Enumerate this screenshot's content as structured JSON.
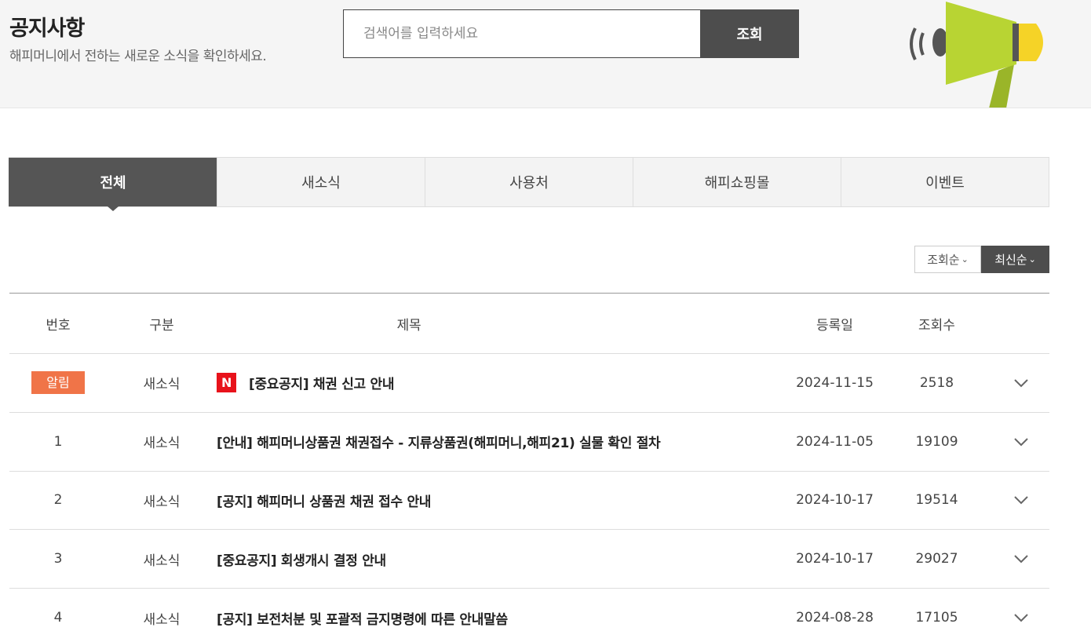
{
  "header": {
    "title": "공지사항",
    "subtitle": "해피머니에서 전하는 새로운 소식을 확인하세요.",
    "search_placeholder": "검색어를 입력하세요",
    "search_button": "조회"
  },
  "tabs": [
    {
      "label": "전체",
      "active": true
    },
    {
      "label": "새소식",
      "active": false
    },
    {
      "label": "사용처",
      "active": false
    },
    {
      "label": "해피쇼핑몰",
      "active": false
    },
    {
      "label": "이벤트",
      "active": false
    }
  ],
  "sort": {
    "views_label": "조회순",
    "latest_label": "최신순",
    "selected": "최신순"
  },
  "table": {
    "headers": {
      "num": "번호",
      "category": "구분",
      "title": "제목",
      "date": "등록일",
      "views": "조회수"
    },
    "rows": [
      {
        "num": "알림",
        "category": "새소식",
        "new_badge": "N",
        "title": "[중요공지] 채권 신고 안내",
        "date": "2024-11-15",
        "views": "2518"
      },
      {
        "num": "1",
        "category": "새소식",
        "title": "[안내] 해피머니상품권 채권접수 - 지류상품권(해피머니,해피21) 실물 확인 절차",
        "date": "2024-11-05",
        "views": "19109"
      },
      {
        "num": "2",
        "category": "새소식",
        "title": "[공지] 해피머니 상품권 채권 접수 안내",
        "date": "2024-10-17",
        "views": "19514"
      },
      {
        "num": "3",
        "category": "새소식",
        "title": "[중요공지] 회생개시 결정 안내",
        "date": "2024-10-17",
        "views": "29027"
      },
      {
        "num": "4",
        "category": "새소식",
        "title": "[공지] 보전처분 및 포괄적 금지명령에 따른 안내말씀",
        "date": "2024-08-28",
        "views": "17105"
      }
    ]
  },
  "colors": {
    "dark": "#4d4d4d",
    "alert_badge": "#f07448",
    "new_badge": "#e8121b",
    "megaphone_green": "#b8d433",
    "megaphone_yellow": "#f5d327"
  }
}
